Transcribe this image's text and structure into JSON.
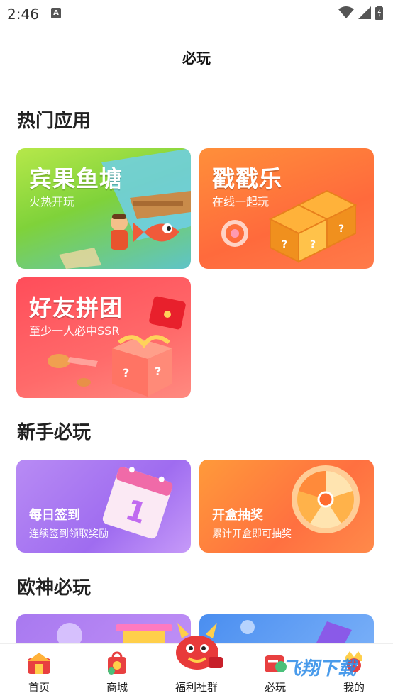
{
  "status": {
    "time": "2:46",
    "notif": "A"
  },
  "page": {
    "title": "必玩"
  },
  "sections": {
    "hot": {
      "title": "热门应用"
    },
    "newbie": {
      "title": "新手必玩"
    },
    "lucky": {
      "title": "欧神必玩"
    }
  },
  "cards": {
    "fish": {
      "title": "宾果鱼塘",
      "subtitle": "火热开玩"
    },
    "chuo": {
      "title": "戳戳乐",
      "subtitle": "在线一起玩"
    },
    "group": {
      "title": "好友拼团",
      "subtitle": "至少一人必中SSR"
    },
    "signin": {
      "title": "每日签到",
      "subtitle": "连续签到领取奖励"
    },
    "lottery": {
      "title": "开盒抽奖",
      "subtitle": "累计开盒即可抽奖"
    }
  },
  "tabs": [
    {
      "label": "首页"
    },
    {
      "label": "商城"
    },
    {
      "label": "福利社群"
    },
    {
      "label": "必玩"
    },
    {
      "label": "我的"
    }
  ],
  "watermark": "飞翔下载",
  "colors": {
    "fish": "#8dd63a",
    "chuo": "#ff7a3a",
    "group": "#ff5a6a",
    "signin": "#a879f0",
    "lottery": "#ff7e3e"
  }
}
